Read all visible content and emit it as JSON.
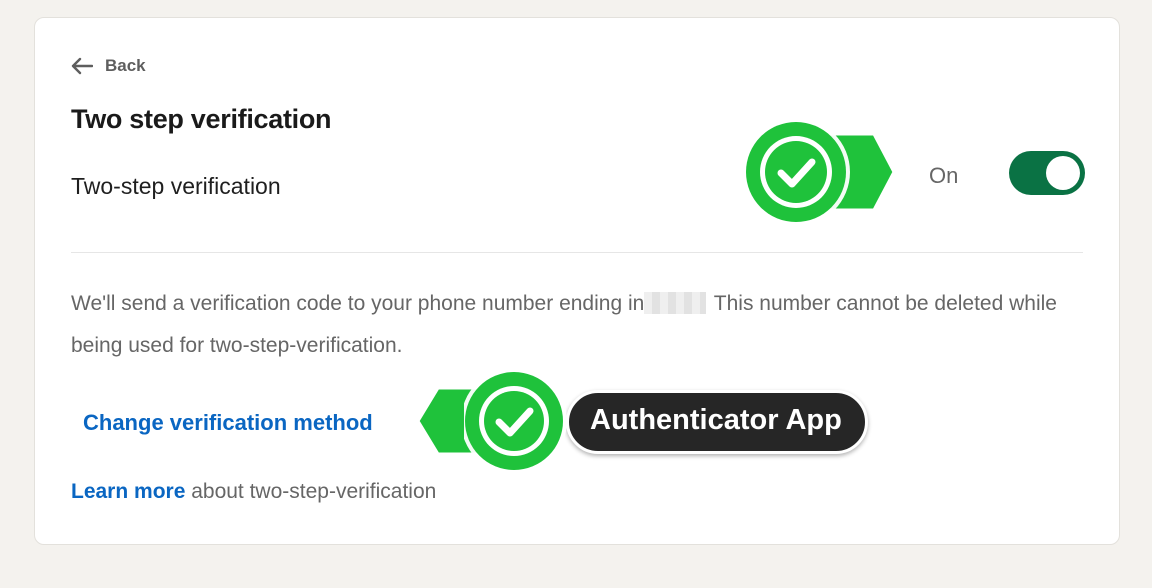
{
  "nav": {
    "back_label": "Back"
  },
  "page": {
    "title": "Two step verification"
  },
  "setting": {
    "label": "Two-step verification",
    "status": "On",
    "enabled": true
  },
  "description": {
    "before": "We'll send a verification code to your phone number ending in",
    "after": " This number cannot be deleted while being used for two-step-verification."
  },
  "change_method_link": "Change verification method",
  "learn_more": {
    "link": "Learn more",
    "text": " about two-step-verification"
  },
  "annotations": {
    "method_label": "Authenticator App",
    "check_color": "#1fc23b"
  },
  "colors": {
    "toggle_on": "#0a7244",
    "link": "#0a66c2",
    "background": "#f4f2ee"
  }
}
